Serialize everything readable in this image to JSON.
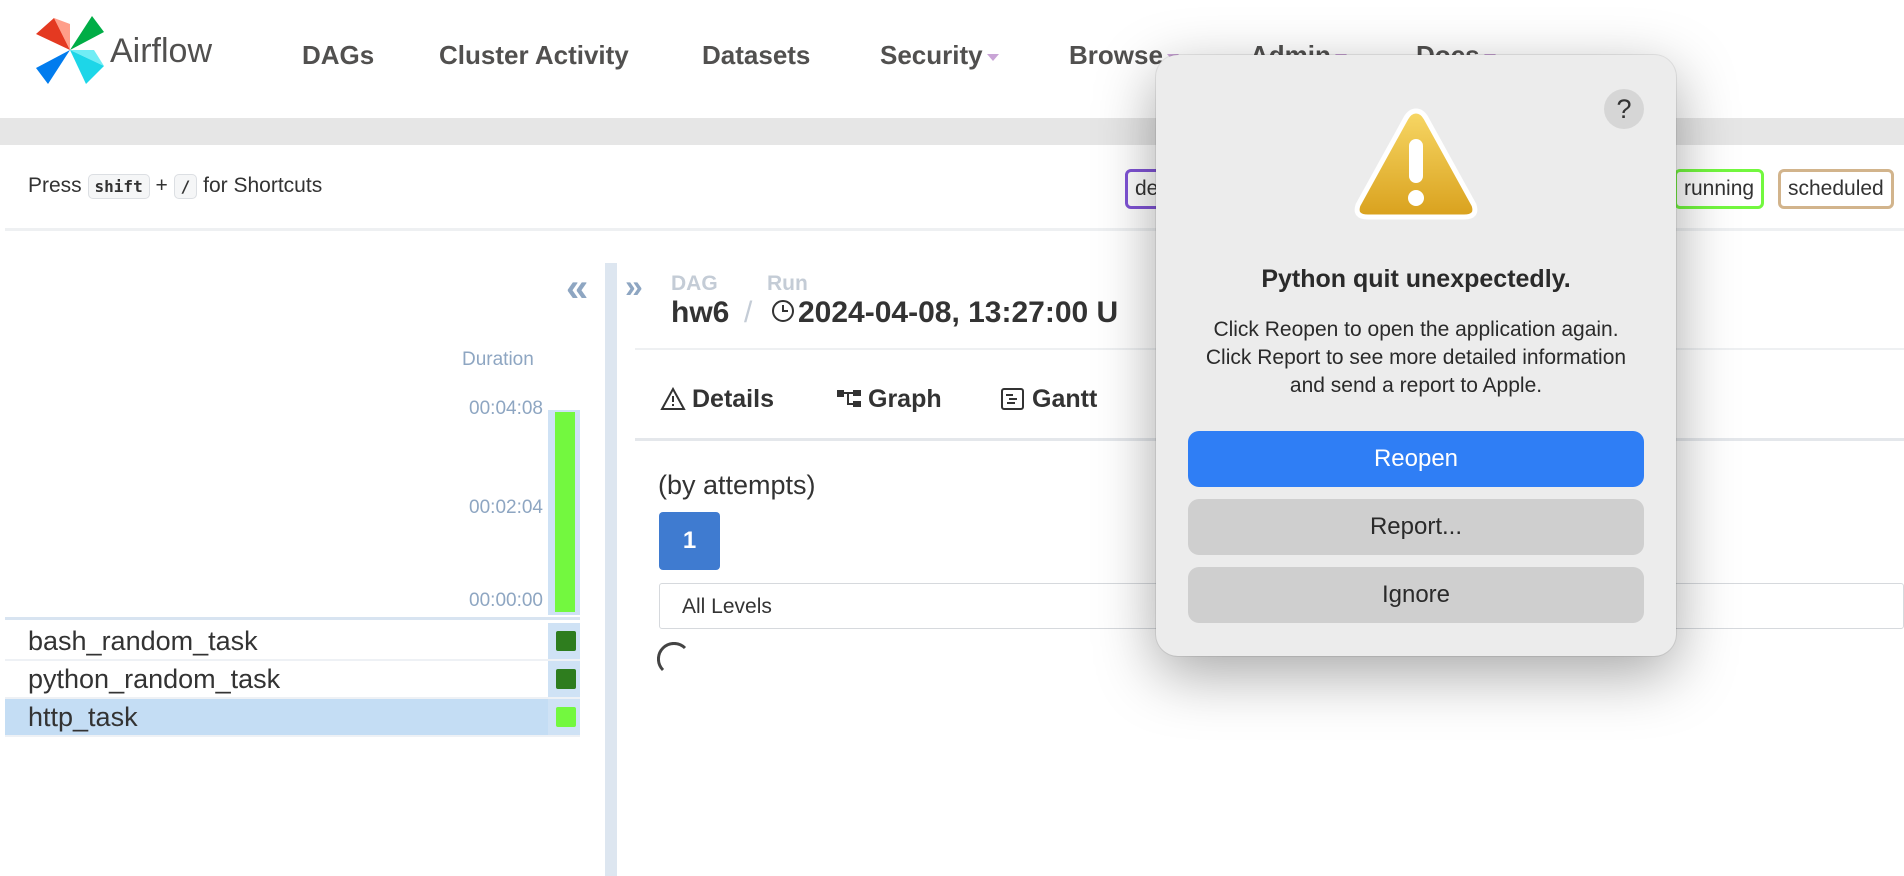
{
  "nav": {
    "brand": "Airflow",
    "items": [
      {
        "label": "DAGs",
        "dropdown": false
      },
      {
        "label": "Cluster Activity",
        "dropdown": false
      },
      {
        "label": "Datasets",
        "dropdown": false
      },
      {
        "label": "Security",
        "dropdown": true
      },
      {
        "label": "Browse",
        "dropdown": true
      },
      {
        "label": "Admin",
        "dropdown": true
      },
      {
        "label": "Docs",
        "dropdown": true
      }
    ]
  },
  "shortcuts": {
    "press": "Press",
    "key1": "shift",
    "plus": "+",
    "key2": "/",
    "suffix": "for Shortcuts"
  },
  "state_badges": [
    {
      "label": "de",
      "color": "#8054d6"
    },
    {
      "label": "running",
      "color": "#73f83f"
    },
    {
      "label": "scheduled",
      "color": "#d2b48c"
    }
  ],
  "grid": {
    "collapse_icon": "«",
    "duration_label": "Duration",
    "duration_ticks": [
      "00:04:08",
      "00:02:04",
      "00:00:00"
    ],
    "run_duration_fraction": 1.0,
    "tasks": [
      {
        "name": "bash_random_task",
        "status_color": "#2e7d1e",
        "selected": false
      },
      {
        "name": "python_random_task",
        "status_color": "#2e7d1e",
        "selected": false
      },
      {
        "name": "http_task",
        "status_color": "#73f83f",
        "selected": true
      }
    ]
  },
  "details": {
    "expand_icon": "»",
    "breadcrumb": {
      "dag_label": "DAG",
      "run_label": "Run",
      "dag": "hw6",
      "sep": "/",
      "run": "2024-04-08, 13:27:00 U"
    },
    "tabs": [
      {
        "label": "Details",
        "icon": "warning-triangle-icon"
      },
      {
        "label": "Graph",
        "icon": "graph-icon"
      },
      {
        "label": "Gantt",
        "icon": "gantt-icon"
      }
    ],
    "attempts_label": "(by attempts)",
    "attempt_number": "1",
    "levels_select": "All Levels"
  },
  "dialog": {
    "help": "?",
    "icon": "warning-icon",
    "title": "Python quit unexpectedly.",
    "message": "Click Reopen to open the application again. Click Report to see more detailed information and send a report to Apple.",
    "buttons": {
      "reopen": "Reopen",
      "report": "Report...",
      "ignore": "Ignore"
    },
    "accent": "#2f7ef5"
  }
}
